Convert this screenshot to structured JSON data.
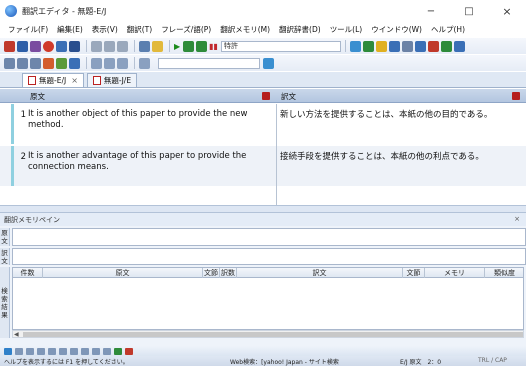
{
  "window": {
    "title": "翻訳エディタ - 無題-E/J",
    "minimize": "−",
    "maximize": "□",
    "close": "×"
  },
  "menu": [
    "ファイル(F)",
    "編集(E)",
    "表示(V)",
    "翻訳(T)",
    "フレーズ/語(P)",
    "翻訳メモリ(M)",
    "翻訳辞書(D)",
    "ツール(L)",
    "ウインドウ(W)",
    "ヘルプ(H)"
  ],
  "toolbar1": {
    "dictionary_combo": "特許"
  },
  "tabs": [
    {
      "label": "無題-E/J",
      "close": "×"
    },
    {
      "label": "無題-J/E"
    }
  ],
  "grid": {
    "col_source": "原文",
    "col_target": "訳文",
    "rows": [
      {
        "num": "1",
        "source": "It is another object of this paper to provide the new method.",
        "target": "新しい方法を提供することは、本紙の他の目的である。"
      },
      {
        "num": "2",
        "source": "It is another advantage of this paper to provide the connection means.",
        "target": "接続手段を提供することは、本紙の他の利点である。"
      }
    ]
  },
  "memory_pane": {
    "title": "翻訳メモリペイン",
    "close": "×",
    "label_source": "原文",
    "label_target": "訳文",
    "label_results": "検索結果",
    "columns": [
      "件数",
      "原文",
      "文節",
      "訳数",
      "訳文",
      "文節",
      "メモリ",
      "類似度"
    ]
  },
  "status": {
    "help": "ヘルプを表示するには F1 を押してください。",
    "web_search": "Web検索：[yahoo! Japan - サイト検索",
    "lang": "E/J 原文　2：0",
    "mode": "TRL / CAP"
  },
  "colors": {
    "accent": "#1b8a1b",
    "marker_red": "#b51d1d",
    "row_stripe": "#8fd0e0"
  }
}
